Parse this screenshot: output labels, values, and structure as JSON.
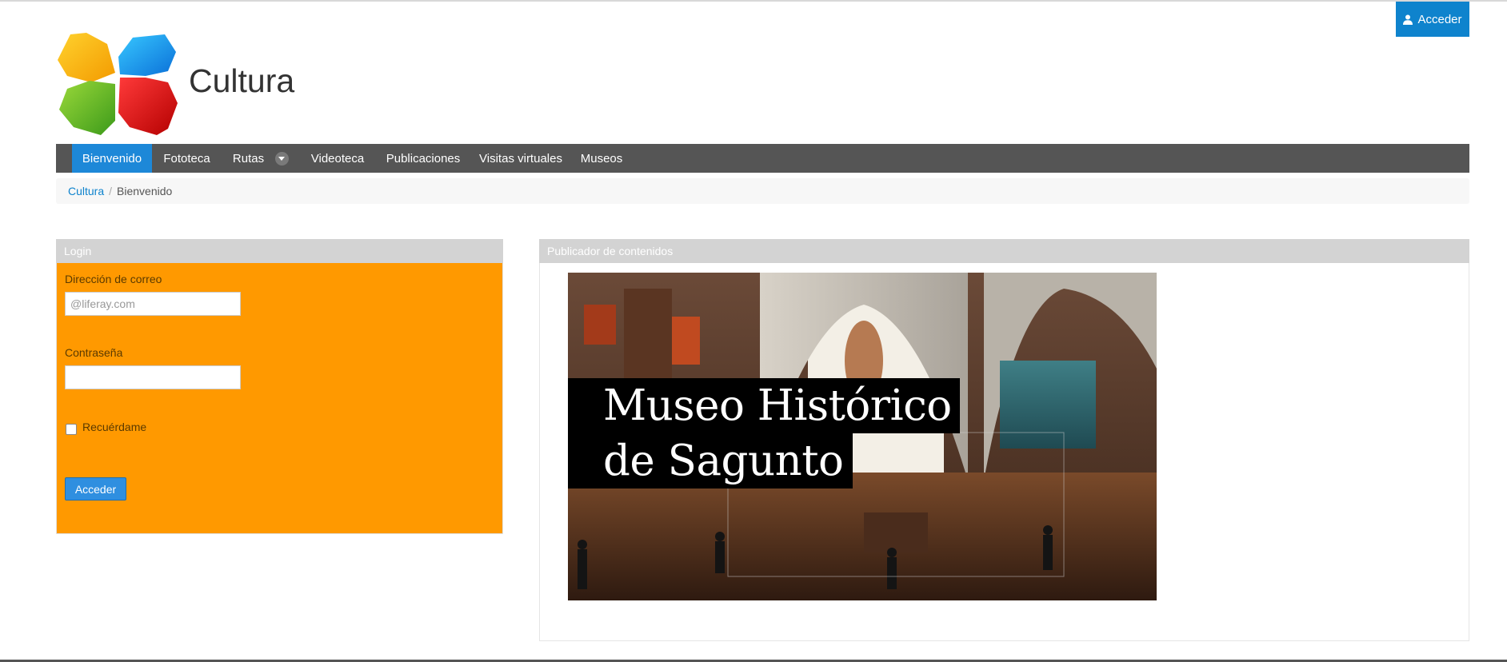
{
  "header": {
    "signin_label": "Acceder",
    "site_name": "Cultura"
  },
  "nav": {
    "items": [
      {
        "label": "Bienvenido",
        "active": true
      },
      {
        "label": "Fototeca"
      },
      {
        "label": "Rutas",
        "has_dropdown": true
      },
      {
        "label": "Videoteca"
      },
      {
        "label": "Publicaciones"
      },
      {
        "label": "Visitas virtuales"
      },
      {
        "label": "Museos"
      }
    ]
  },
  "breadcrumb": {
    "root": "Cultura",
    "separator": "/",
    "current": "Bienvenido"
  },
  "login": {
    "title": "Login",
    "email_label": "Dirección de correo",
    "email_placeholder": "@liferay.com",
    "password_label": "Contraseña",
    "remember_label": "Recuérdame",
    "submit_label": "Acceder"
  },
  "content": {
    "title": "Publicador de contenidos",
    "image_title_line1": "Museo Histórico",
    "image_title_line2": "de Sagunto"
  },
  "colors": {
    "accent": "#0e83cd",
    "nav_bg": "#555555",
    "login_bg": "#ff9900",
    "portlet_header": "#d3d3d3"
  },
  "icons": {
    "signin": "user-icon",
    "dropdown": "caret-down-icon"
  }
}
